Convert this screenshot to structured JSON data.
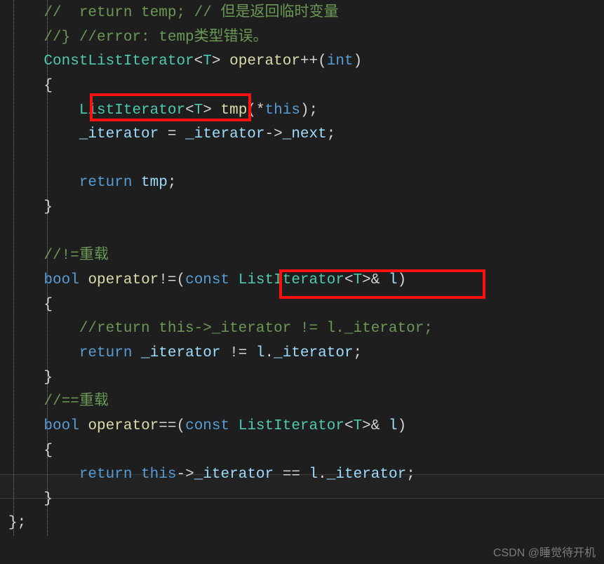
{
  "lines": {
    "l1_a": "//  return temp; // 但是返回临时变量",
    "l2_a": "//} //error: temp类型错误。",
    "l3_a": "ConstListIterator",
    "l3_b": "T",
    "l3_c": "operator",
    "l3_d": "int",
    "l4_a": "{",
    "l5_a": "ListIterator",
    "l5_b": "T",
    "l5_c": "tmp",
    "l5_d": "this",
    "l6_a": "_iterator ",
    "l6_b": "=",
    "l6_c": " _iterator",
    "l6_d": "->",
    "l6_e": "_next",
    "l7_a": "",
    "l8_a": "return",
    "l8_b": " tmp",
    "l9_a": "}",
    "l10_a": "",
    "l11_a": "//!=重载",
    "l12_a": "bool",
    "l12_b": "operator",
    "l12_c": "const",
    "l12_d": "ListIterator",
    "l12_e": "T",
    "l12_f": "l",
    "l13_a": "{",
    "l14_a": "//return this->_iterator != l._iterator;",
    "l15_a": "return",
    "l15_b": " _iterator ",
    "l15_c": "!=",
    "l15_d": " l",
    "l15_e": ".",
    "l15_f": "_iterator",
    "l16_a": "}",
    "l17_a": "//==重载",
    "l18_a": "bool",
    "l18_b": "operator",
    "l18_c": "const",
    "l18_d": "ListIterator",
    "l18_e": "T",
    "l18_f": "l",
    "l19_a": "{",
    "l20_a": "return",
    "l20_b": "this",
    "l20_c": "->",
    "l20_d": "_iterator ",
    "l20_e": "==",
    "l20_f": " l",
    "l20_g": ".",
    "l20_h": "_iterator",
    "l21_a": "}",
    "l22_a": "};"
  },
  "watermark": "CSDN @睡觉待开机"
}
